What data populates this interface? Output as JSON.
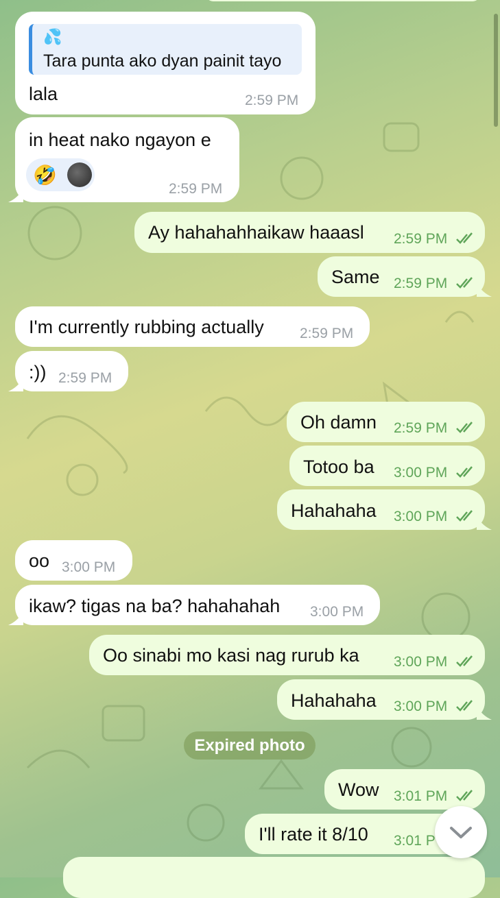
{
  "colors": {
    "outgoing": "#effdde",
    "incoming": "#ffffff",
    "out_time": "#5fa559",
    "in_time": "#9aa0a6",
    "reply_accent": "#3a8de0"
  },
  "reply": {
    "emoji_name": "sweat-droplets-icon",
    "emoji": "💦",
    "quoted_text": "Tara punta ako dyan painit tayo"
  },
  "messages": [
    {
      "id": "m1",
      "dir": "in",
      "text": "lala",
      "time": "2:59 PM"
    },
    {
      "id": "m2",
      "dir": "in",
      "text": "in heat nako ngayon e",
      "time": "2:59 PM",
      "reactions": [
        "🤣"
      ]
    },
    {
      "id": "m3",
      "dir": "out",
      "text": "Ay hahahahhaikaw haaasl",
      "time": "2:59 PM"
    },
    {
      "id": "m4",
      "dir": "out",
      "text": "Same",
      "time": "2:59 PM"
    },
    {
      "id": "m5",
      "dir": "in",
      "text": "I'm currently rubbing actually",
      "time": "2:59 PM"
    },
    {
      "id": "m6",
      "dir": "in",
      "text": ":))",
      "time": "2:59 PM"
    },
    {
      "id": "m7",
      "dir": "out",
      "text": "Oh damn",
      "time": "2:59 PM"
    },
    {
      "id": "m8",
      "dir": "out",
      "text": "Totoo ba",
      "time": "3:00 PM"
    },
    {
      "id": "m9",
      "dir": "out",
      "text": "Hahahaha",
      "time": "3:00 PM"
    },
    {
      "id": "m10",
      "dir": "in",
      "text": "oo",
      "time": "3:00 PM"
    },
    {
      "id": "m11",
      "dir": "in",
      "text": "ikaw? tigas na ba? hahahahah",
      "time": "3:00 PM"
    },
    {
      "id": "m12",
      "dir": "out",
      "text": "Oo sinabi mo kasi nag rurub ka",
      "time": "3:00 PM"
    },
    {
      "id": "m13",
      "dir": "out",
      "text": "Hahahaha",
      "time": "3:00 PM"
    },
    {
      "id": "m14",
      "dir": "out",
      "text": "Wow",
      "time": "3:01 PM"
    },
    {
      "id": "m15",
      "dir": "out",
      "text": "I'll rate it 8/10",
      "time": "3:01 P"
    }
  ],
  "service": {
    "expired_photo": "Expired photo"
  },
  "scroll_down_icon": "chevron-down-icon"
}
